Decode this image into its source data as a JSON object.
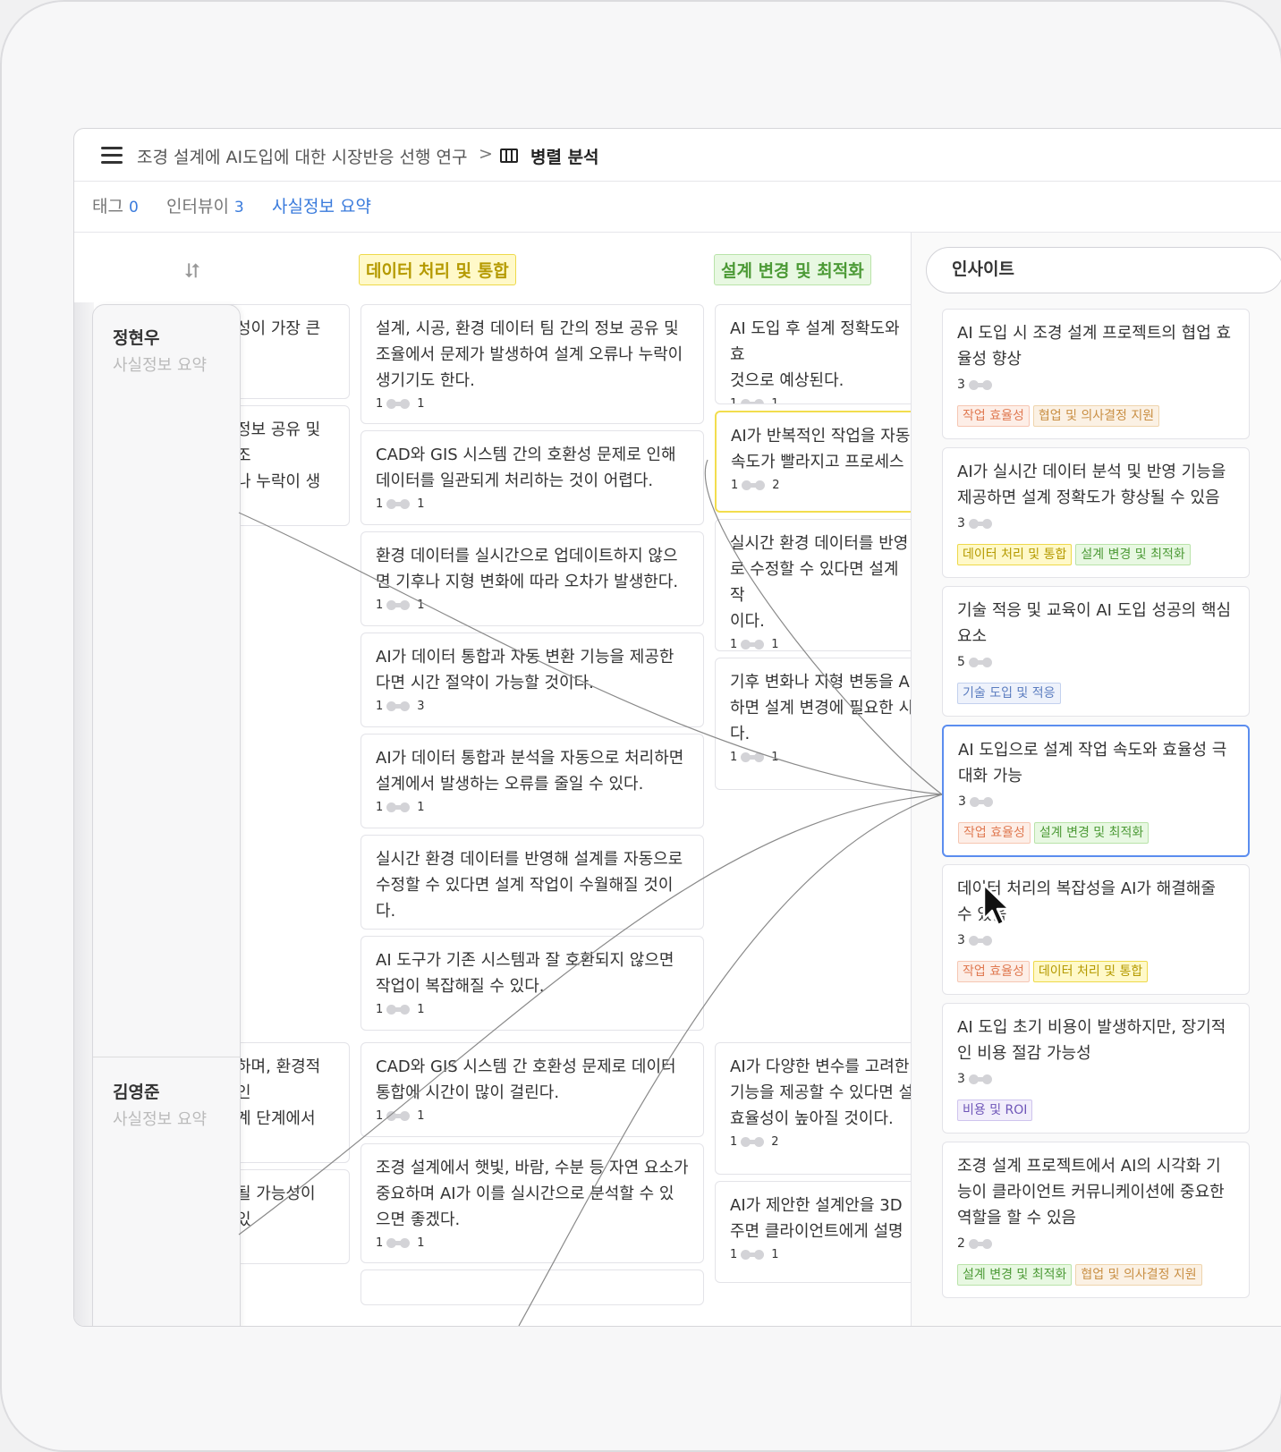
{
  "breadcrumb": {
    "project": "조경 설계에 AI도입에 대한 시장반응 선행 연구",
    "separator": ">",
    "current": "병렬 분석"
  },
  "tabs": [
    {
      "label": "태그",
      "count": "0"
    },
    {
      "label": "인터뷰이",
      "count": "3"
    },
    {
      "label": "사실정보 요약",
      "count": ""
    }
  ],
  "columns": {
    "data": "데이터 처리 및 통합",
    "design": "설계 변경 및 최적화"
  },
  "people": [
    {
      "name": "정현우",
      "sub": "사실정보 요약"
    },
    {
      "name": "김영준",
      "sub": "사실정보 요약"
    }
  ],
  "left_partial_cards": [
    {
      "text": "성이 가장 큰"
    },
    {
      "text": "정보 공유 및 조\n나 누락이 생"
    },
    {
      "text": "하며, 환경적인\n계 단계에서"
    },
    {
      "text": "될 가능성이 있"
    }
  ],
  "data_cards": [
    {
      "text": "설계, 시공, 환경 데이터 팀 간의 정보 공유 및 조율에서 문제가 발생하여 설계 오류나 누락이 생기기도 한다.",
      "left": "1",
      "right": "1"
    },
    {
      "text": "CAD와 GIS 시스템 간의 호환성 문제로 인해 데이터를 일관되게 처리하는 것이 어렵다.",
      "left": "1",
      "right": "1"
    },
    {
      "text": "환경 데이터를 실시간으로 업데이트하지 않으면 기후나 지형 변화에 따라 오차가 발생한다.",
      "left": "1",
      "right": "1"
    },
    {
      "text": "AI가 데이터 통합과 자동 변환 기능을 제공한다면 시간 절약이 가능할 것이다.",
      "left": "1",
      "right": "3"
    },
    {
      "text": "AI가 데이터 통합과 분석을 자동으로 처리하면 설계에서 발생하는 오류를 줄일 수 있다.",
      "left": "1",
      "right": "1"
    },
    {
      "text": "실시간 환경 데이터를 반영해 설계를 자동으로 수정할 수 있다면 설계 작업이 수월해질 것이다.",
      "left": "1",
      "right": "1"
    },
    {
      "text": "AI 도구가 기존 시스템과 잘 호환되지 않으면 작업이 복잡해질 수 있다.",
      "left": "1",
      "right": "1"
    },
    {
      "text": "CAD와 GIS 시스템 간 호환성 문제로 데이터 통합에 시간이 많이 걸린다.",
      "left": "1",
      "right": "1"
    },
    {
      "text": "조경 설계에서 햇빛, 바람, 수분 등 자연 요소가 중요하며 AI가 이를 실시간으로 분석할 수 있으면 좋겠다.",
      "left": "1",
      "right": "1"
    }
  ],
  "design_cards": [
    {
      "text": "AI 도입 후 설계 정확도와 효\n것으로 예상된다.",
      "left": "1",
      "right": "1"
    },
    {
      "text": "AI가 반복적인 작업을 자동\n속도가 빨라지고 프로세스",
      "left": "1",
      "right": "2"
    },
    {
      "text": "실시간 환경 데이터를 반영\n로 수정할 수 있다면 설계 작\n이다.",
      "left": "1",
      "right": "1"
    },
    {
      "text": "기후 변화나 지형 변동을 A\n하면 설계 변경에 필요한 시\n다.",
      "left": "1",
      "right": "1"
    },
    {
      "text": "AI가 다양한 변수를 고려한\n기능을 제공할 수 있다면 설\n효율성이 높아질 것이다.",
      "left": "1",
      "right": "2"
    },
    {
      "text": "AI가 제안한 설계안을 3D\n주면 클라이언트에게 설명",
      "left": "1",
      "right": "1"
    }
  ],
  "insights": {
    "title": "인사이트",
    "items": [
      {
        "text": "AI 도입 시 조경 설계 프로젝트의 협업 효율성 향상",
        "count": "3",
        "chips": [
          "작업 효율성",
          "협업 및 의사결정 지원"
        ]
      },
      {
        "text": "AI가 실시간 데이터 분석 및 반영 기능을 제공하면 설계 정확도가 향상될 수 있음",
        "count": "3",
        "chips": [
          "데이터 처리 및 통합",
          "설계 변경 및 최적화"
        ]
      },
      {
        "text": "기술 적응 및 교육이 AI 도입 성공의 핵심 요소",
        "count": "5",
        "chips": [
          "기술 도입 및 적응"
        ]
      },
      {
        "text": "AI 도입으로 설계 작업 속도와 효율성 극대화 가능",
        "count": "3",
        "chips": [
          "작업 효율성",
          "설계 변경 및 최적화"
        ]
      },
      {
        "text": "데이터 처리의 복잡성을 AI가 해결해줄 수 있음",
        "count": "3",
        "chips": [
          "작업 효율성",
          "데이터 처리 및 통합"
        ]
      },
      {
        "text": "AI 도입 초기 비용이 발생하지만, 장기적인 비용 절감 가능성",
        "count": "3",
        "chips": [
          "비용 및 ROI"
        ]
      },
      {
        "text": "조경 설계 프로젝트에서 AI의 시각화 기능이 클라이언트 커뮤니케이션에 중요한 역할을 할 수 있음",
        "count": "2",
        "chips": [
          "설계 변경 및 최적화",
          "협업 및 의사결정 지원"
        ]
      }
    ]
  },
  "colors": {
    "accent": "#3a7bdc",
    "selected_insight_border": "#5b8def",
    "selected_card_border": "#f2dd4e",
    "link_line": "#8a8a8a"
  }
}
